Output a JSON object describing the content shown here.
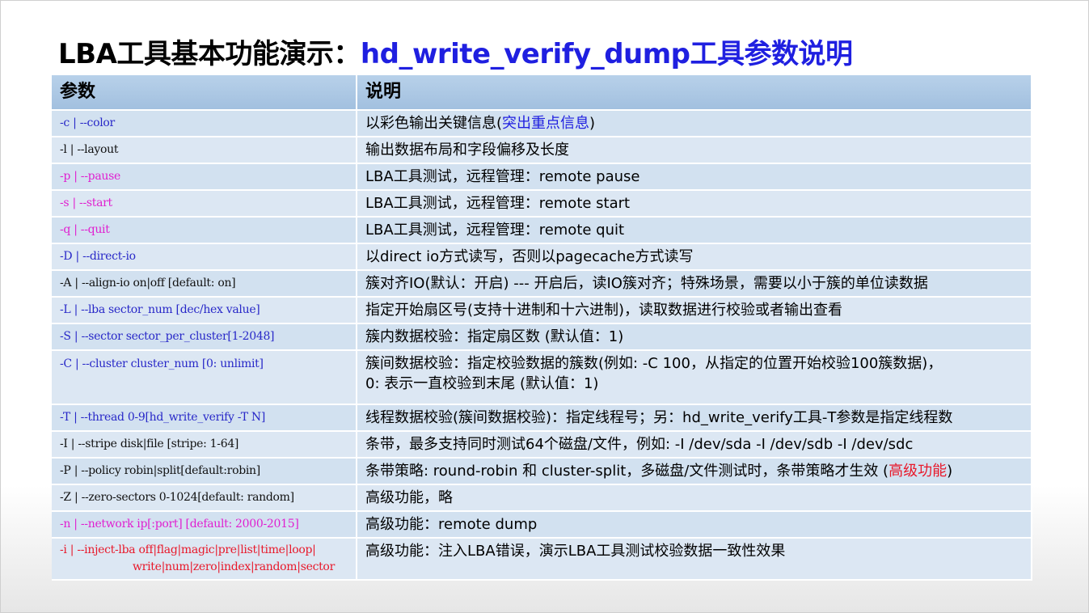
{
  "title": {
    "black": "LBA工具基本功能演示：",
    "blue": "hd_write_verify_dump工具参数说明"
  },
  "table": {
    "headers": [
      "参数",
      "说明"
    ],
    "rows": [
      {
        "param": "-c | --color",
        "param_color": "blue",
        "desc_a": "以彩色输出关键信息(",
        "desc_hl": "突出重点信息",
        "desc_b": ")"
      },
      {
        "param": "-l | --layout",
        "param_color": "black",
        "desc_a": "输出数据布局和字段偏移及长度"
      },
      {
        "param": "-p | --pause",
        "param_color": "magenta",
        "desc_a": "LBA工具测试，远程管理：remote pause"
      },
      {
        "param": "-s | --start",
        "param_color": "magenta",
        "desc_a": "LBA工具测试，远程管理：remote start"
      },
      {
        "param": "-q | --quit",
        "param_color": "magenta",
        "desc_a": "LBA工具测试，远程管理：remote quit"
      },
      {
        "param": "-D | --direct-io",
        "param_color": "blue",
        "desc_a": "以direct io方式读写，否则以pagecache方式读写"
      },
      {
        "param": "-A | --align-io on|off [default: on]",
        "param_color": "black",
        "desc_a": "簇对齐IO(默认：开启) --- 开启后，读IO簇对齐；特殊场景，需要以小于簇的单位读数据"
      },
      {
        "param": "-L | --lba  sector_num [dec/hex value]",
        "param_color": "blue",
        "desc_a": "指定开始扇区号(支持十进制和十六进制)，读取数据进行校验或者输出查看"
      },
      {
        "param": "-S | --sector sector_per_cluster[1-2048]",
        "param_color": "blue",
        "desc_a": "簇内数据校验：指定扇区数 (默认值：1)"
      },
      {
        "param": "-C | --cluster cluster_num [0:  unlimit]",
        "param_color": "blue",
        "desc_a": "簇间数据校验：指定校验数据的簇数(例如: -C 100，从指定的位置开始校验100簇数据)，",
        "desc_line2": "0: 表示一直校验到末尾 (默认值：1)"
      },
      {
        "param": "-T | --thread  0-9[hd_write_verify -T N]",
        "param_color": "blue",
        "desc_a": "线程数据校验(簇间数据校验)：指定线程号；另：hd_write_verify工具-T参数是指定线程数"
      },
      {
        "param": "-I | --stripe  disk|file [stripe:  1-64]",
        "param_color": "black",
        "desc_a": "条带，最多支持同时测试64个磁盘/文件，例如: -I /dev/sda -I /dev/sdb -I /dev/sdc"
      },
      {
        "param": "-P | --policy robin|split[default:robin]",
        "param_color": "black",
        "desc_a": "条带策略: round-robin 和 cluster-split，多磁盘/文件测试时，条带策略才生效  (",
        "desc_hl": "高级功能",
        "desc_b": ")"
      },
      {
        "param": "-Z | --zero-sectors 0-1024[default: random]",
        "param_color": "black",
        "desc_red": "高级功能，略"
      },
      {
        "param": "-n | --network ip[:port] [default: 2000-2015]",
        "param_color": "magenta",
        "desc_red": "高级功能：remote dump"
      },
      {
        "param": "-i | --inject-lba off|flag|magic|pre|list|time|loop|",
        "param_line2": "write|num|zero|index|random|sector",
        "param_color": "red",
        "desc_red": "高级功能：注入LBA错误，演示LBA工具测试校验数据一致性效果"
      }
    ]
  }
}
